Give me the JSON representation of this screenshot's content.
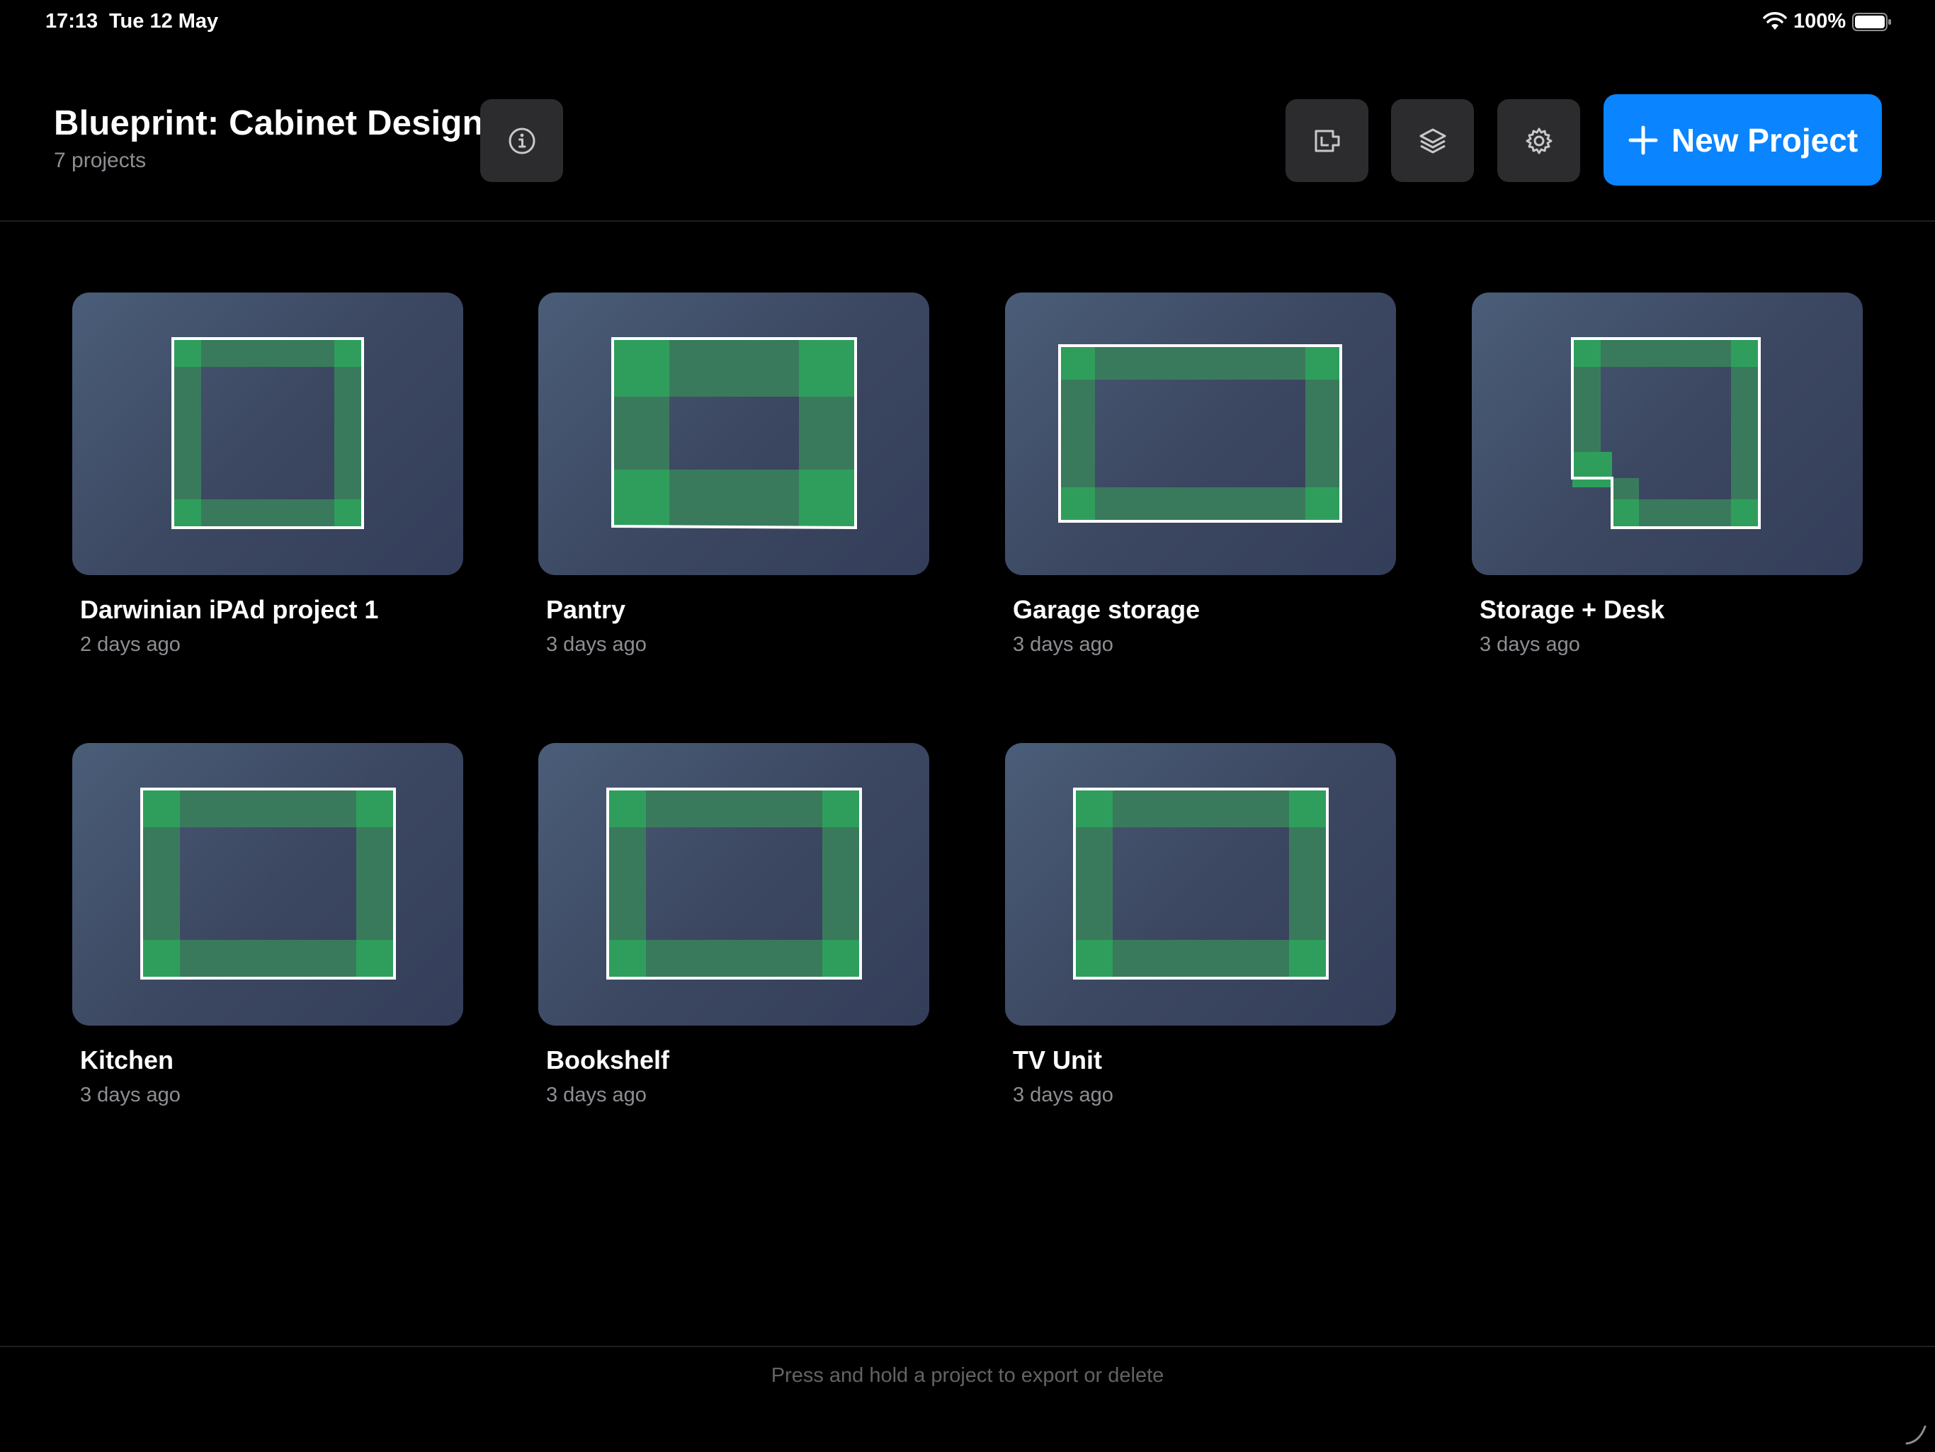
{
  "status_bar": {
    "time": "17:13",
    "date": "Tue 12 May",
    "battery": "100%"
  },
  "header": {
    "title": "Blueprint: Cabinet Design",
    "subtitle": "7 projects",
    "new_project_label": "New Project",
    "accent": "#0a84ff"
  },
  "projects": [
    {
      "name": "Darwinian iPAd project 1",
      "date": "2 days ago"
    },
    {
      "name": "Pantry",
      "date": "3 days ago"
    },
    {
      "name": "Garage storage",
      "date": "3 days ago"
    },
    {
      "name": "Storage + Desk",
      "date": "3 days ago"
    },
    {
      "name": "Kitchen",
      "date": "3 days ago"
    },
    {
      "name": "Bookshelf",
      "date": "3 days ago"
    },
    {
      "name": "TV Unit",
      "date": "3 days ago"
    }
  ],
  "footer": {
    "hint": "Press and hold a project to export or delete"
  },
  "colors": {
    "cabinet_fill": "#3a7a5c",
    "cabinet_corner": "#2f9e5c",
    "outline": "#ffffff"
  }
}
